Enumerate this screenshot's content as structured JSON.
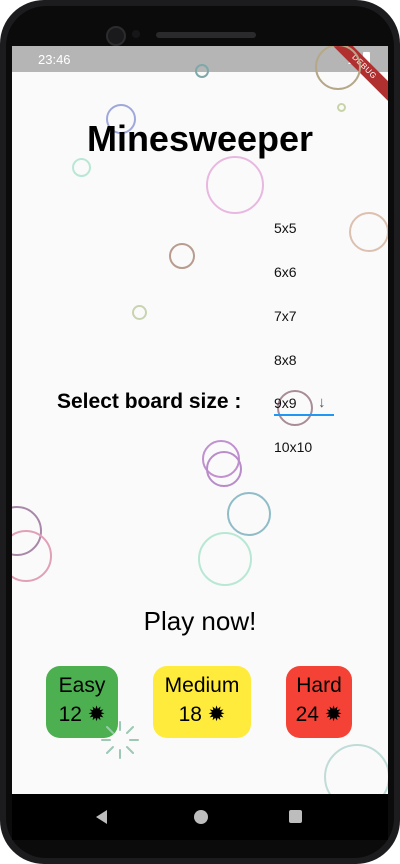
{
  "status_bar": {
    "time": "23:46",
    "debug_banner": "DEBUG"
  },
  "app": {
    "title": "Minesweeper",
    "board_size_label": "Select board size :",
    "board_size_options": [
      "5x5",
      "6x6",
      "7x7",
      "8x8",
      "9x9",
      "10x10"
    ],
    "board_size_selected": "9x9",
    "play_label": "Play now!",
    "difficulties": [
      {
        "name": "Easy",
        "mines": "12",
        "color": "#4caf50"
      },
      {
        "name": "Medium",
        "mines": "18",
        "color": "#ffeb3b"
      },
      {
        "name": "Hard",
        "mines": "24",
        "color": "#f44336"
      }
    ],
    "mine_icon": "mine-burst-icon"
  },
  "nav": {
    "back_icon": "back-triangle-icon",
    "home_icon": "home-circle-icon",
    "recents_icon": "recents-square-icon"
  }
}
